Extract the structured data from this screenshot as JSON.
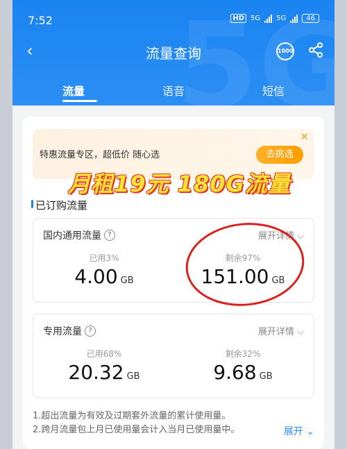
{
  "status": {
    "time": "7:52",
    "hd": "HD",
    "net1": "5G",
    "net2": "5G",
    "battery": "46"
  },
  "nav": {
    "title": "流量查询",
    "svc_label": "1000"
  },
  "tabs": [
    {
      "label": "流量"
    },
    {
      "label": "语音"
    },
    {
      "label": "短信"
    }
  ],
  "promo": {
    "text": "特惠流量专区，超低价 随心选",
    "button": "去挑选",
    "overlay": "月租19元 180G流量"
  },
  "section_title": "已订购流量",
  "domestic": {
    "title": "国内通用流量",
    "detail": "展开详情",
    "used_label": "已用3%",
    "used_value": "4.00",
    "used_unit": "GB",
    "remain_label": "剩余97%",
    "remain_value": "151.00",
    "remain_unit": "GB"
  },
  "special": {
    "title": "专用流量",
    "detail": "展开详情",
    "used_label": "已用68%",
    "used_value": "20.32",
    "used_unit": "GB",
    "remain_label": "剩余32%",
    "remain_value": "9.68",
    "remain_unit": "GB"
  },
  "notes": [
    "1.超出流量为有效及过期套外流量的累计使用量。",
    "2.跨月流量包上月已使用量会计入当月已使用量中。"
  ],
  "expand_label": "展开",
  "colors": {
    "accent": "#1a84f2",
    "promo_button": "#ff9d00",
    "annotation": "#d9211d"
  }
}
